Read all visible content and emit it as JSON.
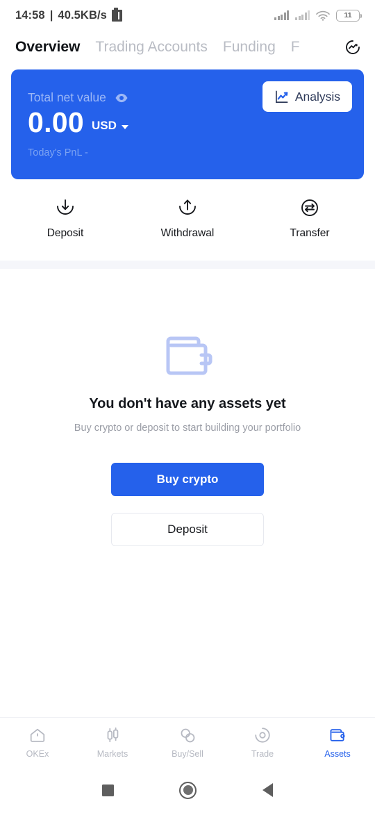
{
  "statusbar": {
    "time": "14:58",
    "separator": "|",
    "network_speed": "40.5KB/s",
    "battery_level": "11",
    "app_icon": "app-notification-icon",
    "signal_icon": "signal-bars-icon",
    "signal2_icon": "signal-bars-secondary-icon",
    "wifi_icon": "wifi-icon"
  },
  "tabs": {
    "items": [
      {
        "label": "Overview",
        "active": true
      },
      {
        "label": "Trading Accounts",
        "active": false
      },
      {
        "label": "Funding",
        "active": false
      },
      {
        "label": "F",
        "active": false
      }
    ],
    "refresh_icon": "refresh-circle-icon"
  },
  "card": {
    "label": "Total net value",
    "eye_icon": "eye-icon",
    "amount": "0.00",
    "currency": "USD",
    "currency_caret_icon": "chevron-down-icon",
    "pnl_label": "Today's PnL",
    "pnl_value": "-",
    "analysis_label": "Analysis",
    "analysis_icon": "line-chart-icon",
    "bg_color": "#2561EB",
    "label_color": "#9cb7f6"
  },
  "actions": [
    {
      "label": "Deposit",
      "icon": "download-circle-icon"
    },
    {
      "label": "Withdrawal",
      "icon": "upload-circle-icon"
    },
    {
      "label": "Transfer",
      "icon": "transfer-circle-icon"
    }
  ],
  "empty": {
    "wallet_icon": "wallet-icon",
    "wallet_icon_color": "#b8c6f5",
    "title": "You don't have any assets yet",
    "subtitle": "Buy crypto or deposit to start building your portfolio",
    "primary_button": "Buy crypto",
    "secondary_button": "Deposit"
  },
  "bottomnav": {
    "items": [
      {
        "label": "OKEx",
        "icon": "home-icon",
        "active": false
      },
      {
        "label": "Markets",
        "icon": "candlestick-icon",
        "active": false
      },
      {
        "label": "Buy/Sell",
        "icon": "two-circles-icon",
        "active": false
      },
      {
        "label": "Trade",
        "icon": "trade-circle-icon",
        "active": false
      },
      {
        "label": "Assets",
        "icon": "wallet-icon",
        "active": true
      }
    ],
    "active_color": "#2561EB",
    "inactive_color": "#b6b9c2"
  },
  "androidnav": {
    "recents_icon": "recents-square-icon",
    "home_icon": "home-circle-icon",
    "back_icon": "back-triangle-icon"
  }
}
